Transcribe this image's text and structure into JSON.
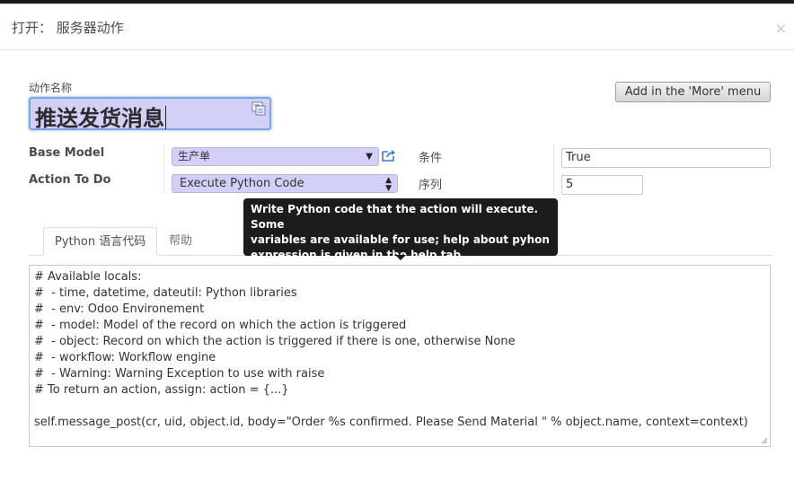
{
  "header": {
    "title": "打开： 服务器动作",
    "close_glyph": "×"
  },
  "action_name": {
    "label": "动作名称",
    "value": "推送发货消息"
  },
  "more_menu_button": "Add in the 'More' menu",
  "fields": {
    "base_model": {
      "label": "Base Model",
      "value": "生产单"
    },
    "action_to_do": {
      "label": "Action To Do",
      "value": "Execute Python Code"
    },
    "condition": {
      "label": "条件",
      "value": "True"
    },
    "sequence": {
      "label": "序列",
      "value": "5"
    }
  },
  "tabs": [
    {
      "label": "Python 语言代码",
      "active": true
    },
    {
      "label": "帮助",
      "active": false
    }
  ],
  "tooltip": {
    "lines": [
      "Write Python code that the action will execute. Some",
      "variables are available for use; help about pyhon",
      "expression is given in the help tab."
    ]
  },
  "code": {
    "lines": [
      "# Available locals:",
      "#  - time, datetime, dateutil: Python libraries",
      "#  - env: Odoo Environement",
      "#  - model: Model of the record on which the action is triggered",
      "#  - object: Record on which the action is triggered if there is one, otherwise None",
      "#  - workflow: Workflow engine",
      "#  - Warning: Warning Exception to use with raise",
      "# To return an action, assign: action = {...}",
      "",
      "self.message_post(cr, uid, object.id, body=\"Order %s confirmed. Please Send Material \" % object.name, context=context)"
    ]
  },
  "icons": {
    "translate": "translate-icon",
    "external_link": "external-link-icon",
    "select_arrows": "chevron-down-icon",
    "resize": "resize-handle-icon"
  },
  "colors": {
    "required_field_bg": "#d3d0f8",
    "focus_border": "#7ea8e0",
    "tooltip_bg": "#1c1c1c",
    "link_blue": "#3a7bd5"
  }
}
